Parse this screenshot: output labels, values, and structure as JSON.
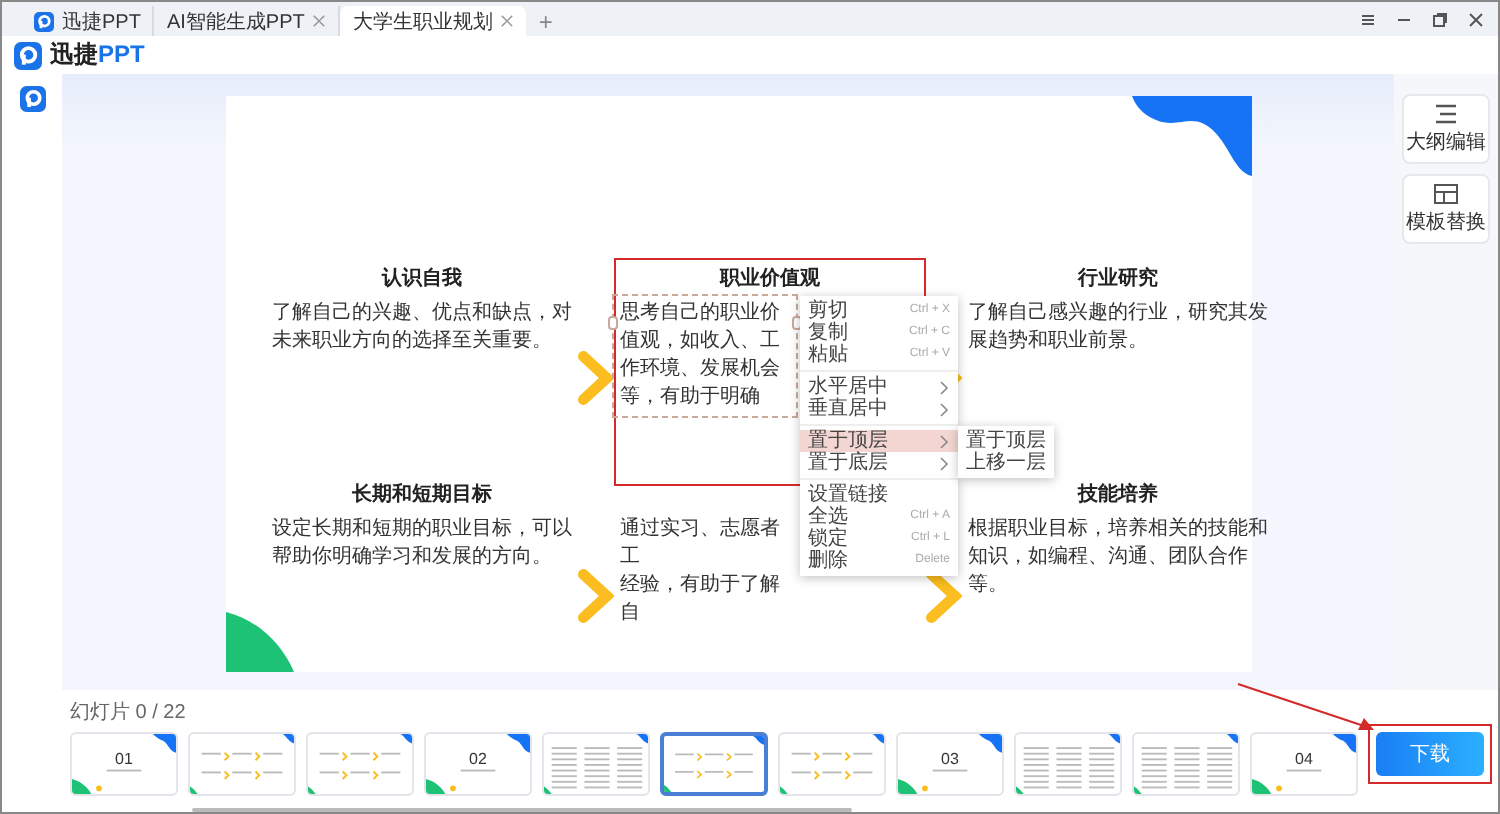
{
  "tabs": [
    {
      "label": "迅捷PPT",
      "kind": "home",
      "selected": false
    },
    {
      "label": "AI智能生成PPT",
      "kind": "doc",
      "selected": false
    },
    {
      "label": "大学生职业规划",
      "kind": "doc",
      "selected": true
    }
  ],
  "new_tab": "+",
  "brand": {
    "name": "迅捷",
    "accent": "PPT"
  },
  "side_tools": [
    {
      "label": "大纲编辑",
      "kind": "outline"
    },
    {
      "label": "模板替换",
      "kind": "template"
    }
  ],
  "slide": {
    "sections": [
      {
        "title": "认识自我",
        "lines": [
          "了解自己的兴趣、优点和缺点，对未来职业方向的选择至关重要。"
        ],
        "selected": false,
        "highlighted": false
      },
      {
        "title": "职业价值观",
        "lines": [
          "思考自己的职业价值观，如收入、工作环境、发展机会等，有助于明确"
        ],
        "selected": true,
        "highlighted": true
      },
      {
        "title": "行业研究",
        "lines": [
          "了解自己感兴趣的行业，研究其发展趋势和职业前景。"
        ],
        "selected": false,
        "highlighted": false
      },
      {
        "title": "长期和短期目标",
        "lines": [
          "设定长期和短期的职业目标，可以帮助你明确学习和发展的方向。"
        ],
        "selected": false,
        "highlighted": false
      },
      {
        "lines": [
          "通过实习、志愿者工",
          "经验，有助于了解自"
        ],
        "selected": false,
        "highlighted": false
      },
      {
        "title": "技能培养",
        "lines": [
          "根据职业目标，培养相关的技能和知识，如编程、沟通、团队合作等。"
        ],
        "selected": false,
        "highlighted": false
      }
    ]
  },
  "context_menu": {
    "items": [
      {
        "kind": "item",
        "label": "剪切",
        "shortcut": "Ctrl + X",
        "selected": false
      },
      {
        "kind": "item",
        "label": "复制",
        "shortcut": "Ctrl + C",
        "selected": false
      },
      {
        "kind": "item",
        "label": "粘贴",
        "shortcut": "Ctrl + V",
        "selected": false
      },
      {
        "kind": "separator"
      },
      {
        "kind": "submenu",
        "label": "水平居中",
        "selected": false
      },
      {
        "kind": "submenu",
        "label": "垂直居中",
        "selected": false
      },
      {
        "kind": "separator"
      },
      {
        "kind": "submenu",
        "label": "置于顶层",
        "selected": true
      },
      {
        "kind": "submenu",
        "label": "置于底层",
        "selected": false
      },
      {
        "kind": "separator"
      },
      {
        "kind": "item",
        "label": "设置链接",
        "selected": false
      },
      {
        "kind": "item",
        "label": "全选",
        "shortcut": "Ctrl + A",
        "selected": false
      },
      {
        "kind": "item",
        "label": "锁定",
        "shortcut": "Ctrl + L",
        "selected": false
      },
      {
        "kind": "item",
        "label": "删除",
        "shortcut": "Delete",
        "selected": false
      }
    ],
    "submenu": [
      "置于顶层",
      "上移一层"
    ]
  },
  "slide_counter": "幻灯片 0 / 22",
  "thumbnails": [
    {
      "kind": "title",
      "number": "01",
      "selected": false
    },
    {
      "kind": "content",
      "selected": false
    },
    {
      "kind": "content",
      "selected": false
    },
    {
      "kind": "title",
      "number": "02",
      "selected": false
    },
    {
      "kind": "dense",
      "selected": false
    },
    {
      "kind": "content",
      "selected": true
    },
    {
      "kind": "content",
      "selected": false
    },
    {
      "kind": "title",
      "number": "03",
      "selected": false
    },
    {
      "kind": "dense",
      "selected": false
    },
    {
      "kind": "dense",
      "selected": false
    },
    {
      "kind": "title",
      "number": "04",
      "selected": false
    }
  ],
  "download": {
    "label": "下载",
    "highlighted": true
  },
  "callout_arrow": true
}
